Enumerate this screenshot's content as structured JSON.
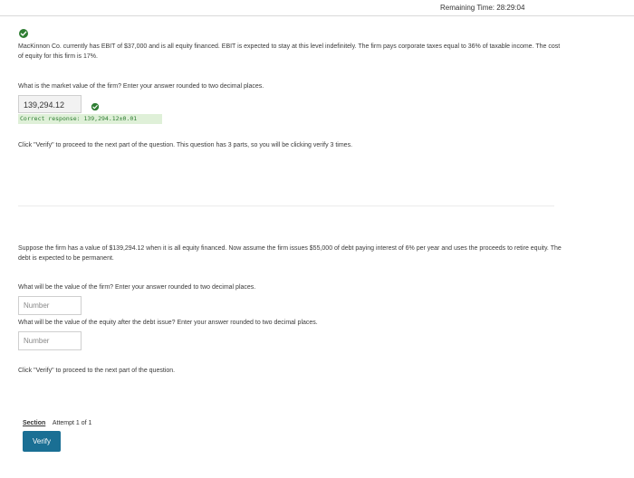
{
  "header": {
    "remaining_time": "Remaining Time:  28:29:04"
  },
  "part1": {
    "problem": "MacKinnon Co. currently has EBIT of $37,000 and is all equity financed. EBIT is expected to stay at this level indefinitely. The firm pays corporate taxes equal to 36% of taxable income. The cost of equity for this firm is 17%.",
    "question": "What is the market value of the firm?  Enter your answer rounded to two decimal places.",
    "answer_value": "139,294.12",
    "correct_response": "Correct response: 139,294.12±0.01",
    "instruction": "Click \"Verify\" to proceed to the next part of the question.  This question has 3 parts, so you will be clicking verify 3 times."
  },
  "part2": {
    "problem": "Suppose the firm has a value of $139,294.12 when it is all equity financed. Now assume the firm issues $55,000 of debt paying interest of 6% per year and uses the proceeds to retire equity. The debt is expected to be permanent.",
    "question1": "What will be the value of the firm?  Enter your answer rounded to two decimal places.",
    "input1_placeholder": "Number",
    "question2": "What will be the value of the equity after the debt issue?  Enter your answer rounded to two decimal places.",
    "input2_placeholder": "Number",
    "instruction": "Click \"Verify\" to proceed to the next part of the question."
  },
  "footer": {
    "section_label": "Section",
    "attempt_text": "Attempt 1 of 1",
    "verify_label": "Verify"
  },
  "colors": {
    "accent": "#1a6f94",
    "success": "#2e7d32",
    "success_bg": "#dff0d8"
  },
  "icons": {
    "status": "check-circle-icon"
  }
}
